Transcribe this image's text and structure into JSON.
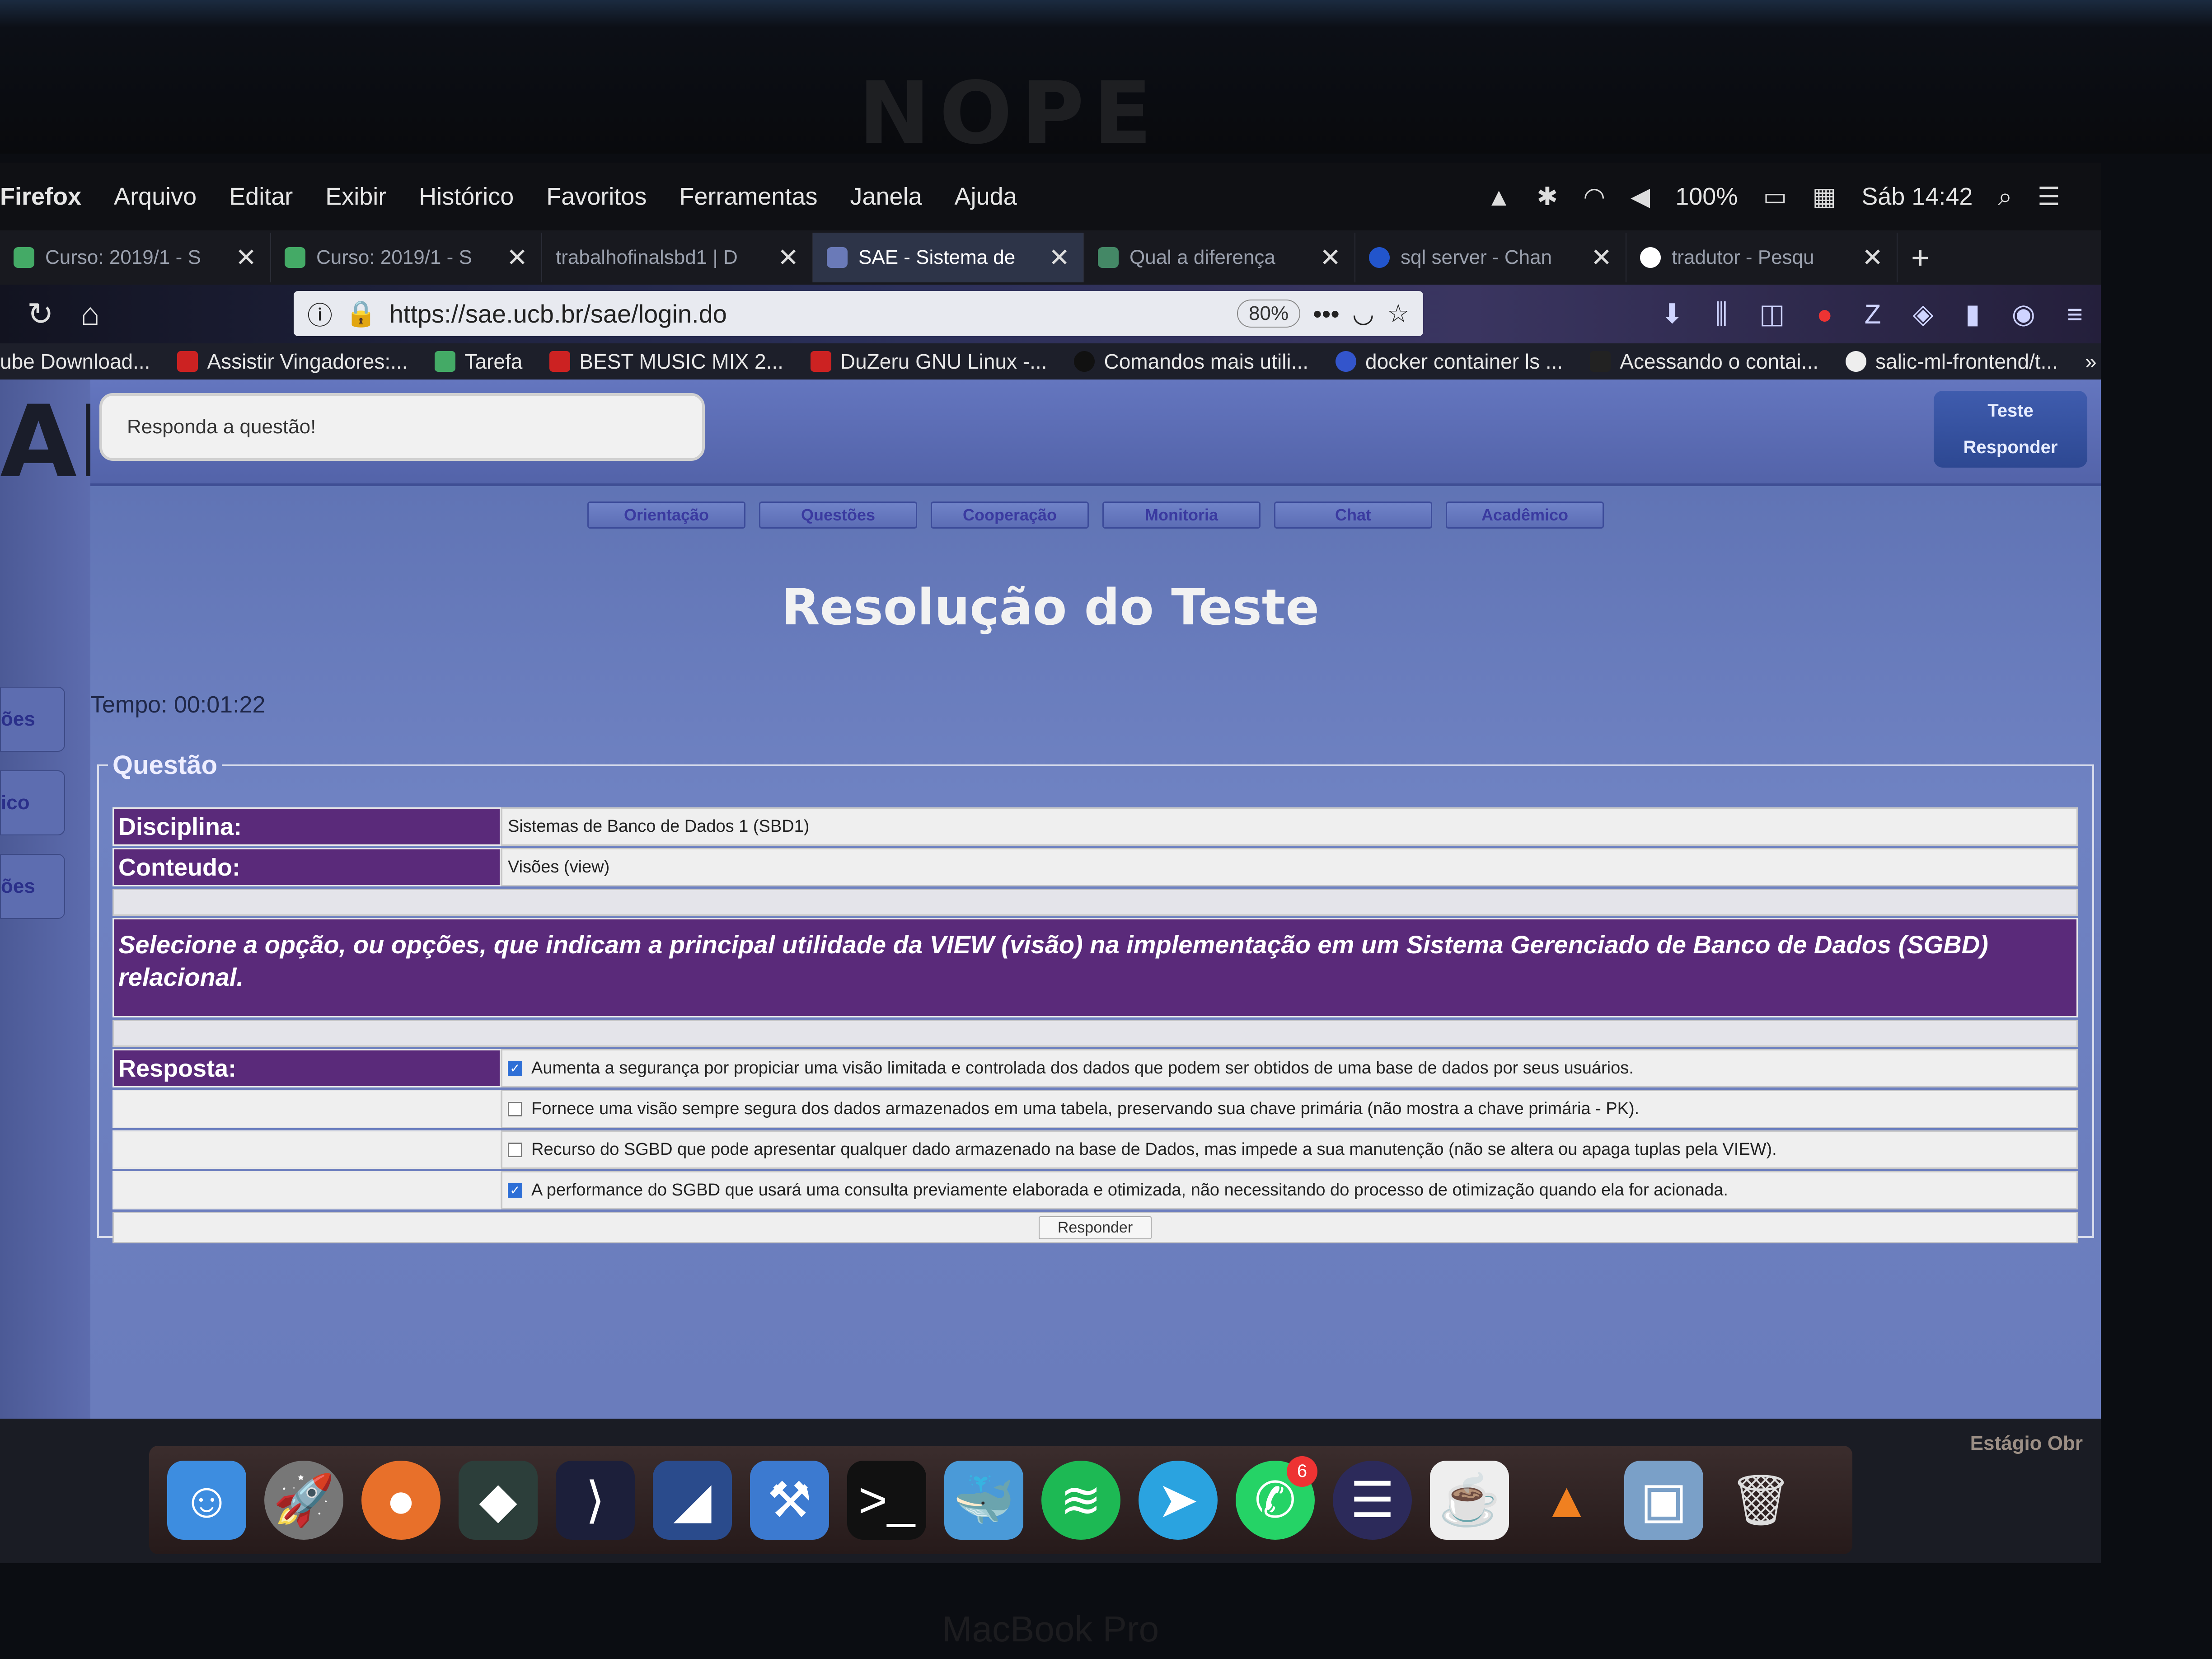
{
  "bezel": {
    "logo": "NOPE",
    "bottom_label": "MacBook Pro"
  },
  "menubar": {
    "app_name": "Firefox",
    "items": [
      "Arquivo",
      "Editar",
      "Exibir",
      "Histórico",
      "Favoritos",
      "Ferramentas",
      "Janela",
      "Ajuda"
    ],
    "battery": "100%",
    "clock": "Sáb 14:42"
  },
  "tabs": [
    {
      "title": "Curso: 2019/1 - S"
    },
    {
      "title": "Curso: 2019/1 - S"
    },
    {
      "title": "trabalhofinalsbd1 | D"
    },
    {
      "title": "SAE - Sistema de"
    },
    {
      "title": "Qual a diferença"
    },
    {
      "title": "sql server - Chan"
    },
    {
      "title": "tradutor - Pesqu"
    }
  ],
  "toolbar": {
    "url": "https://sae.ucb.br/sae/login.do",
    "zoom": "80%"
  },
  "bookmarks": [
    "ube Download...",
    "Assistir Vingadores:...",
    "Tarefa",
    "BEST MUSIC MIX 2...",
    "DuZeru GNU Linux -...",
    "Comandos mais utili...",
    "docker container ls ...",
    "Acessando o contai...",
    "salic-ml-frontend/t..."
  ],
  "sae": {
    "logo": "AE",
    "side_tabs": [
      "ões",
      "ico",
      "ões"
    ],
    "message": "Responda a questão!",
    "corner": {
      "line1": "Teste",
      "line2": "Responder"
    },
    "nav": [
      "Orientação",
      "Questões",
      "Cooperação",
      "Monitoria",
      "Chat",
      "Acadêmico"
    ],
    "title": "Resolução do Teste",
    "timer": "Tempo: 00:01:22",
    "question": {
      "legend": "Questão",
      "disciplina_label": "Disciplina:",
      "disciplina": "Sistemas de Banco de Dados 1 (SBD1)",
      "conteudo_label": "Conteudo:",
      "conteudo": "Visões (view)",
      "text": "Selecione a opção, ou opções, que indicam a principal utilidade da VIEW (visão) na implementação em um Sistema Gerenciado de Banco de Dados (SGBD) relacional.",
      "resposta_label": "Resposta:",
      "options": [
        {
          "text": "Aumenta a segurança por propiciar uma visão limitada e controlada dos dados que podem ser obtidos de uma base de dados por seus usuários.",
          "checked": true
        },
        {
          "text": "Fornece uma visão sempre segura dos dados armazenados em uma tabela, preservando sua chave primária (não mostra a chave primária - PK).",
          "checked": false
        },
        {
          "text": "Recurso do SGBD que pode apresentar qualquer dado armazenado na base de Dados, mas impede a sua manutenção (não se altera ou apaga tuplas pela VIEW).",
          "checked": false
        },
        {
          "text": "A performance do SGBD que usará uma consulta previamente elaborada e otimizada, não necessitando do processo de otimização quando ela for acionada.",
          "checked": true
        }
      ],
      "submit": "Responder"
    }
  },
  "dock": {
    "whatsapp_badge": "6"
  },
  "desktop": {
    "label": "Estágio Obr"
  }
}
